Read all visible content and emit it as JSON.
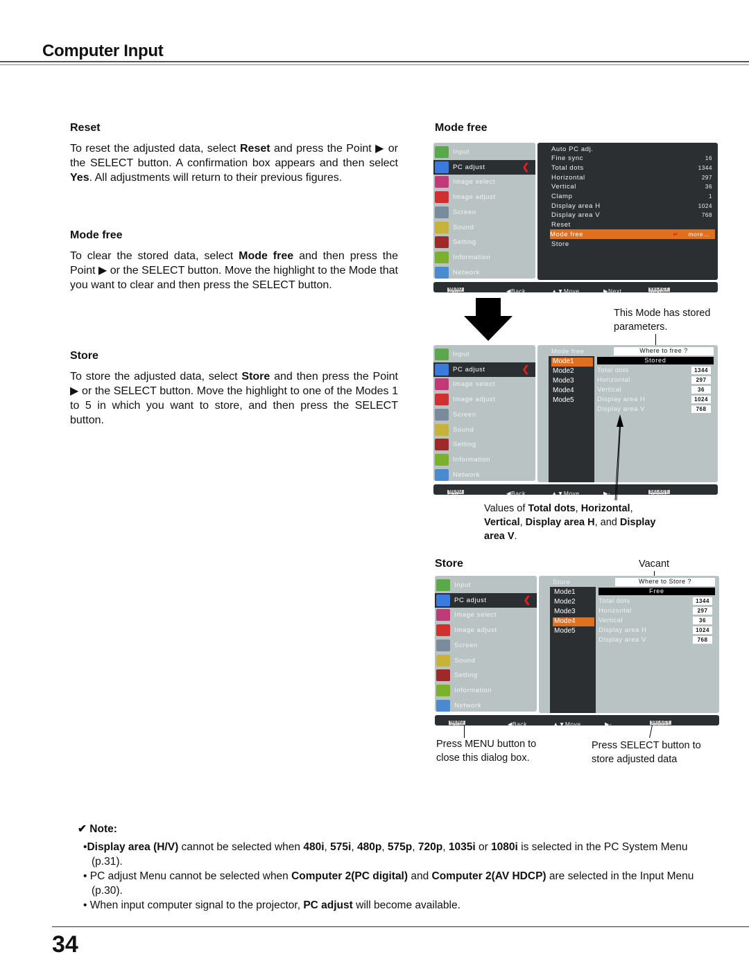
{
  "page": {
    "title": "Computer Input",
    "page_number": "34"
  },
  "left": {
    "reset": {
      "heading": "Reset",
      "text": [
        {
          "t": "To reset the adjusted data, select "
        },
        {
          "t": "Reset",
          "b": true
        },
        {
          "t": " and press the Point ▶ or the SELECT button. A confirmation box appears and then select "
        },
        {
          "t": "Yes",
          "b": true
        },
        {
          "t": ". All adjustments will return to their previous figures."
        }
      ]
    },
    "mode_free": {
      "heading": "Mode free",
      "text": [
        {
          "t": "To clear the stored data, select "
        },
        {
          "t": "Mode free",
          "b": true
        },
        {
          "t": " and then press the Point ▶ or the SELECT button. Move the highlight to the Mode that you want to clear and then press the SELECT button."
        }
      ]
    },
    "store": {
      "heading": "Store",
      "text": [
        {
          "t": "To store the adjusted data, select "
        },
        {
          "t": "Store",
          "b": true
        },
        {
          "t": " and then press the Point ▶ or the SELECT button. Move the highlight to one of the Modes 1 to 5 in which you want to store, and then press the SELECT button."
        }
      ]
    }
  },
  "right": {
    "mode_free_heading": "Mode free",
    "store_heading": "Store",
    "caption_stored": "This Mode has stored parameters.",
    "caption_values": [
      {
        "t": "Values of "
      },
      {
        "t": "Total dots",
        "b": true
      },
      {
        "t": ", "
      },
      {
        "t": "Horizontal",
        "b": true
      },
      {
        "t": ", "
      },
      {
        "t": "Vertical",
        "b": true
      },
      {
        "t": ", "
      },
      {
        "t": "Display area H",
        "b": true
      },
      {
        "t": ", and "
      },
      {
        "t": "Display area V",
        "b": true
      },
      {
        "t": "."
      }
    ],
    "caption_vacant": "Vacant",
    "caption_menu": "Press MENU button to close this dialog box.",
    "caption_select": "Press SELECT button to store adjusted data"
  },
  "osd": {
    "sidebar": [
      {
        "label": "Input",
        "icon": "input-icon",
        "color": "#5aa84a"
      },
      {
        "label": "PC adjust",
        "icon": "pc-adjust-icon",
        "color": "#3a7be0"
      },
      {
        "label": "Image select",
        "icon": "image-select-icon",
        "color": "#c03a7a"
      },
      {
        "label": "Image adjust",
        "icon": "image-adjust-icon",
        "color": "#d03030"
      },
      {
        "label": "Screen",
        "icon": "screen-icon",
        "color": "#7a8c9c"
      },
      {
        "label": "Sound",
        "icon": "sound-icon",
        "color": "#c9b23a"
      },
      {
        "label": "Setting",
        "icon": "setting-icon",
        "color": "#a02828"
      },
      {
        "label": "Information",
        "icon": "information-icon",
        "color": "#7ab02a"
      },
      {
        "label": "Network",
        "icon": "network-icon",
        "color": "#4a8ad0"
      }
    ],
    "active_index": 1,
    "pc_adjust_items": [
      {
        "label": "Auto PC adj.",
        "value": ""
      },
      {
        "label": "Fine sync",
        "value": "16"
      },
      {
        "label": "Total dots",
        "value": "1344"
      },
      {
        "label": "Horizontal",
        "value": "297"
      },
      {
        "label": "Vertical",
        "value": "36"
      },
      {
        "label": "Clamp",
        "value": "1"
      },
      {
        "label": "Display area H",
        "value": "1024"
      },
      {
        "label": "Display area V",
        "value": "768"
      },
      {
        "label": "Reset",
        "value": ""
      },
      {
        "label": "Mode free",
        "value": "more...",
        "highlighted": true
      },
      {
        "label": "Store",
        "value": ""
      }
    ],
    "footer1": [
      {
        "key": "MENU",
        "label": "Exit"
      },
      {
        "key": "",
        "label": "◀Back"
      },
      {
        "key": "",
        "label": "▲▼Move"
      },
      {
        "key": "",
        "label": "▶Next"
      },
      {
        "key": "SELECT",
        "label": "Next"
      }
    ],
    "footer2": [
      {
        "key": "MENU",
        "label": "Exit"
      },
      {
        "key": "",
        "label": "◀Back"
      },
      {
        "key": "",
        "label": "▲▼Move"
      },
      {
        "key": "",
        "label": "▶-----"
      },
      {
        "key": "SELECT",
        "label": "Select"
      }
    ],
    "modes": [
      "Mode1",
      "Mode2",
      "Mode3",
      "Mode4",
      "Mode5"
    ],
    "params": [
      {
        "label": "Total dots",
        "value": "1344"
      },
      {
        "label": "Horizontal",
        "value": "297"
      },
      {
        "label": "Vertical",
        "value": "36"
      },
      {
        "label": "Display area H",
        "value": "1024"
      },
      {
        "label": "Display area V",
        "value": "768"
      }
    ],
    "dialog_free": {
      "title": "Mode free",
      "prompt": "Where to free ?",
      "status": "Stored",
      "selected_mode": 0
    },
    "dialog_store": {
      "title": "Store",
      "prompt": "Where to Store ?",
      "status": "Free",
      "selected_mode": 3
    }
  },
  "note": {
    "heading": "✔ Note:",
    "items": [
      [
        {
          "t": "•"
        },
        {
          "t": "Display area (H/V)",
          "b": true
        },
        {
          "t": " cannot be selected when "
        },
        {
          "t": "480i",
          "b": true
        },
        {
          "t": ", "
        },
        {
          "t": "575i",
          "b": true
        },
        {
          "t": ", "
        },
        {
          "t": "480p",
          "b": true
        },
        {
          "t": ", "
        },
        {
          "t": "575p",
          "b": true
        },
        {
          "t": ", "
        },
        {
          "t": "720p",
          "b": true
        },
        {
          "t": ", "
        },
        {
          "t": "1035i",
          "b": true
        },
        {
          "t": " or "
        },
        {
          "t": "1080i",
          "b": true
        },
        {
          "t": " is selected in the PC System Menu (p.31)."
        }
      ],
      [
        {
          "t": "• PC adjust Menu cannot be selected when "
        },
        {
          "t": "Computer 2(PC digital)",
          "b": true
        },
        {
          "t": " and "
        },
        {
          "t": "Computer 2(AV HDCP)",
          "b": true
        },
        {
          "t": " are selected in the Input Menu (p.30)."
        }
      ],
      [
        {
          "t": "• When input computer signal to the projector, "
        },
        {
          "t": "PC adjust",
          "b": true
        },
        {
          "t": " will become available."
        }
      ]
    ]
  }
}
